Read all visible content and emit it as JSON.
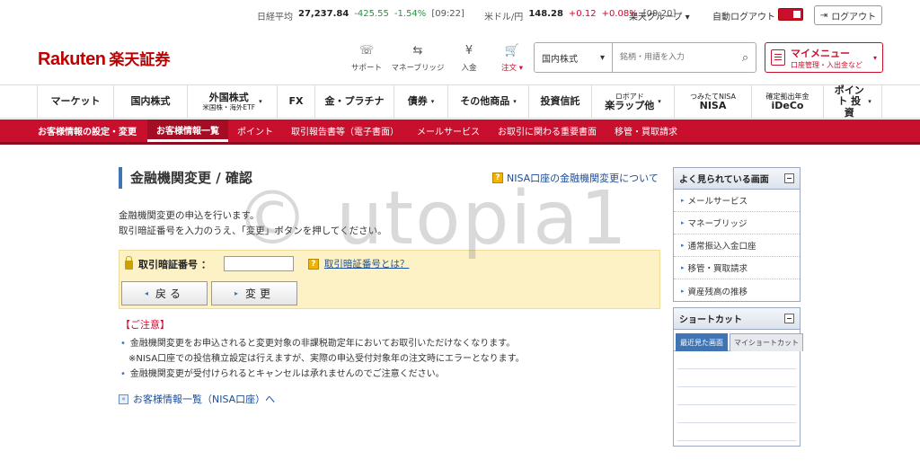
{
  "ticker": {
    "nikkei_label": "日経平均",
    "nikkei_value": "27,237.84",
    "nikkei_change": "-425.55",
    "nikkei_pct": "-1.54%",
    "nikkei_time": "[09:22]",
    "usd_label": "米ドル/円",
    "usd_value": "148.28",
    "usd_change": "+0.12",
    "usd_pct": "+0.08%",
    "usd_time": "[09:20]",
    "group_label": "楽天グループ ▾",
    "auto_logout_label": "自動ログアウト",
    "logout_label": "ログアウト"
  },
  "header": {
    "logo_en": "Rakuten",
    "logo_jp": "楽天証券",
    "icons": [
      {
        "label": "サポート",
        "glyph": "☏"
      },
      {
        "label": "マネーブリッジ",
        "glyph": "⇆"
      },
      {
        "label": "入金",
        "glyph": "¥"
      },
      {
        "label": "注文 ▾",
        "glyph": "🛒"
      }
    ],
    "search_select": "国内株式",
    "search_placeholder": "銘柄・用語を入力",
    "mymenu_title": "マイメニュー",
    "mymenu_sub": "口座管理・入出金など"
  },
  "main_nav": [
    {
      "label": "マーケット",
      "sub": "",
      "caret": ""
    },
    {
      "label": "国内株式",
      "sub": "",
      "caret": ""
    },
    {
      "label": "外国株式",
      "sub": "米国株・海外ETF",
      "caret": "▾"
    },
    {
      "label": "FX",
      "sub": "",
      "caret": ""
    },
    {
      "label": "金・プラチナ",
      "sub": "",
      "caret": ""
    },
    {
      "label": "債券",
      "sub": "",
      "caret": "▾"
    },
    {
      "label": "その他商品",
      "sub": "",
      "caret": "▾"
    },
    {
      "label": "投資信託",
      "sub": "",
      "caret": ""
    },
    {
      "label": "楽ラップ他",
      "sub": "ロボアド",
      "caret": "▾"
    },
    {
      "label": "NISA",
      "sub": "つみたてNISA",
      "caret": ""
    },
    {
      "label": "iDeCo",
      "sub": "確定拠出年金",
      "caret": ""
    },
    {
      "label": "ポイント 投資",
      "sub": "",
      "caret": "▾"
    }
  ],
  "sub_nav": {
    "title": "お客様情報の設定・変更",
    "items": [
      "お客様情報一覧",
      "ポイント",
      "取引報告書等（電子書面）",
      "メールサービス",
      "お取引に関わる重要書面",
      "移管・買取請求"
    ]
  },
  "content": {
    "page_title": "金融機関変更 / 確認",
    "help_link": "NISA口座の金融機関変更について",
    "intro_line1": "金融機関変更の申込を行います。",
    "intro_line2": "取引暗証番号を入力のうえ、「変更」ボタンを押してください。",
    "code_label": "取引暗証番号 ：",
    "code_help": "取引暗証番号とは？",
    "back_button": "戻る",
    "change_button": "変更",
    "caution_head": "【ご注意】",
    "caution_1": "金融機関変更をお申込されると変更対象の非課税勘定年においてお取引いただけなくなります。",
    "caution_note": "※NISA口座での投信積立設定は行えますが、実際の申込受付対象年の注文時にエラーとなります。",
    "caution_2": "金融機関変更が受付けられるとキャンセルは承れませんのでご注意ください。",
    "back_link": "お客様情報一覧（NISA口座）へ"
  },
  "sidebar": {
    "popular_title": "よく見られている画面",
    "popular_items": [
      "メールサービス",
      "マネーブリッジ",
      "通常振込入金口座",
      "移管・買取請求",
      "資産残高の推移"
    ],
    "shortcut_title": "ショートカット",
    "tab_recent": "最近見た画面",
    "tab_my": "マイショートカット"
  },
  "watermark": "© utopia1",
  "colors": {
    "brand": "#bf0000",
    "nav_red": "#c8102e",
    "link": "#1a4d9c",
    "accent_blue": "#3f74b5"
  }
}
